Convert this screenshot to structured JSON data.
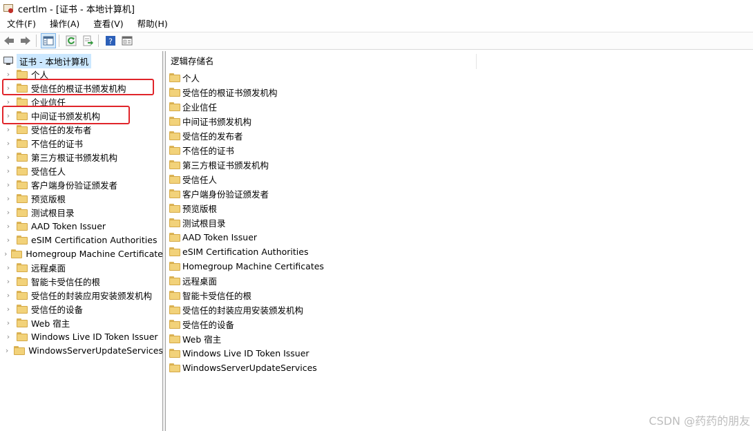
{
  "window": {
    "title": "certlm - [证书 - 本地计算机]"
  },
  "menu": [
    "文件(F)",
    "操作(A)",
    "查看(V)",
    "帮助(H)"
  ],
  "toolbar": {
    "icons": [
      "back-arrow-icon",
      "forward-arrow-icon",
      "show-hide-tree-icon",
      "refresh-icon",
      "export-list-icon",
      "help-icon",
      "properties-icon"
    ]
  },
  "tree": {
    "root": "证书 - 本地计算机",
    "items": [
      "个人",
      "受信任的根证书颁发机构",
      "企业信任",
      "中间证书颁发机构",
      "受信任的发布者",
      "不信任的证书",
      "第三方根证书颁发机构",
      "受信任人",
      "客户端身份验证颁发者",
      "预览版根",
      "测试根目录",
      "AAD Token Issuer",
      "eSIM Certification Authorities",
      "Homegroup Machine Certificates",
      "远程桌面",
      "智能卡受信任的根",
      "受信任的封装应用安装颁发机构",
      "受信任的设备",
      "Web 宿主",
      "Windows Live ID Token Issuer",
      "WindowsServerUpdateServices"
    ]
  },
  "list": {
    "column": "逻辑存储名",
    "items": [
      "个人",
      "受信任的根证书颁发机构",
      "企业信任",
      "中间证书颁发机构",
      "受信任的发布者",
      "不信任的证书",
      "第三方根证书颁发机构",
      "受信任人",
      "客户端身份验证颁发者",
      "预览版根",
      "测试根目录",
      "AAD Token Issuer",
      "eSIM Certification Authorities",
      "Homegroup Machine Certificates",
      "远程桌面",
      "智能卡受信任的根",
      "受信任的封装应用安装颁发机构",
      "受信任的设备",
      "Web 宿主",
      "Windows Live ID Token Issuer",
      "WindowsServerUpdateServices"
    ]
  },
  "watermark": "CSDN @药药的朋友",
  "colors": {
    "selection": "#cce8ff",
    "highlight": "#e0242a",
    "folder": "#f2d27a"
  }
}
